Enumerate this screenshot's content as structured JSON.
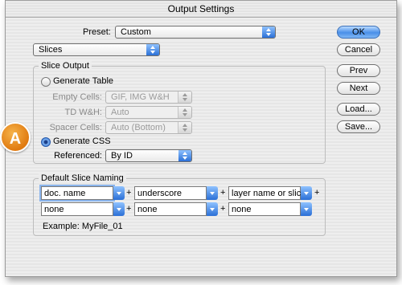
{
  "window": {
    "title": "Output Settings"
  },
  "preset": {
    "label": "Preset:",
    "value": "Custom"
  },
  "section_select": {
    "value": "Slices"
  },
  "slice_output": {
    "group_title": "Slice Output",
    "generate_table": {
      "label": "Generate Table",
      "selected": false
    },
    "empty_cells": {
      "label": "Empty Cells:",
      "value": "GIF, IMG W&H"
    },
    "td_wh": {
      "label": "TD W&H:",
      "value": "Auto"
    },
    "spacer_cells": {
      "label": "Spacer Cells:",
      "value": "Auto (Bottom)"
    },
    "generate_css": {
      "label": "Generate CSS",
      "selected": true
    },
    "referenced": {
      "label": "Referenced:",
      "value": "By ID"
    }
  },
  "naming": {
    "group_title": "Default Slice Naming",
    "row1": [
      "doc. name",
      "underscore",
      "layer name or slice"
    ],
    "row2": [
      "none",
      "none",
      "none"
    ],
    "plus": "+",
    "example": "Example: MyFile_01"
  },
  "buttons": {
    "ok": "OK",
    "cancel": "Cancel",
    "prev": "Prev",
    "next": "Next",
    "load": "Load...",
    "save": "Save..."
  },
  "callout": {
    "letter": "A",
    "color": "#e8891c"
  }
}
